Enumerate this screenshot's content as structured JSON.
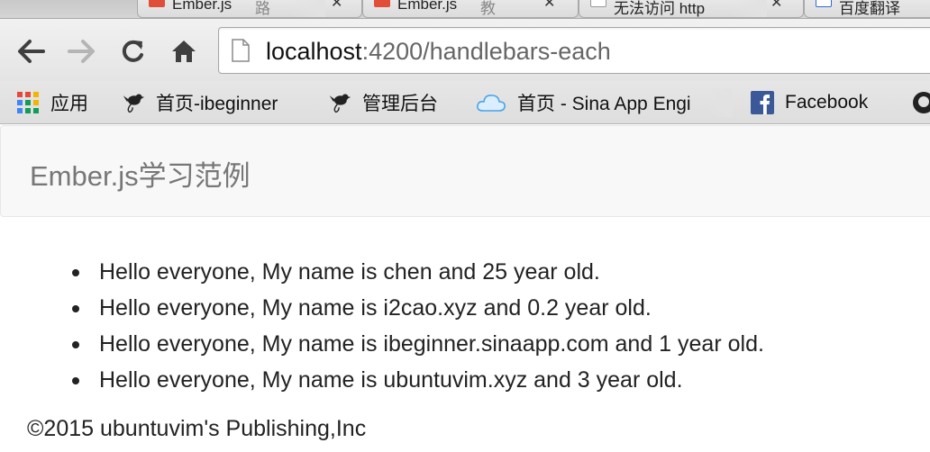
{
  "tabs": [
    {
      "title": "Ember.js",
      "suffix": "路"
    },
    {
      "title": "Ember.js",
      "suffix": "教"
    },
    {
      "title": "无法访问 http"
    },
    {
      "title": "百度翻译"
    }
  ],
  "address_bar": {
    "host": "localhost",
    "rest": ":4200/handlebars-each"
  },
  "bookmarks": [
    {
      "label": "应用",
      "icon": "apps-grid-icon"
    },
    {
      "label": "首页-ibeginner",
      "icon": "bird-icon"
    },
    {
      "label": "管理后台",
      "icon": "bird-icon"
    },
    {
      "label": "首页 - Sina App Engi",
      "icon": "cloud-icon"
    },
    {
      "label": "Facebook",
      "icon": "facebook-icon"
    }
  ],
  "page": {
    "brand": "Ember.js学习范例",
    "people": [
      "Hello everyone, My name is chen and 25 year old.",
      "Hello everyone, My name is i2cao.xyz and 0.2 year old.",
      "Hello everyone, My name is ibeginner.sinaapp.com and 1 year old.",
      "Hello everyone, My name is ubuntuvim.xyz and 3 year old."
    ],
    "footer": "©2015 ubuntuvim's Publishing,Inc"
  },
  "colors": {
    "ember_red": "#e04e39",
    "facebook_blue": "#3b5998",
    "navbar_bg": "#f8f8f8",
    "brand_text": "#777777"
  }
}
